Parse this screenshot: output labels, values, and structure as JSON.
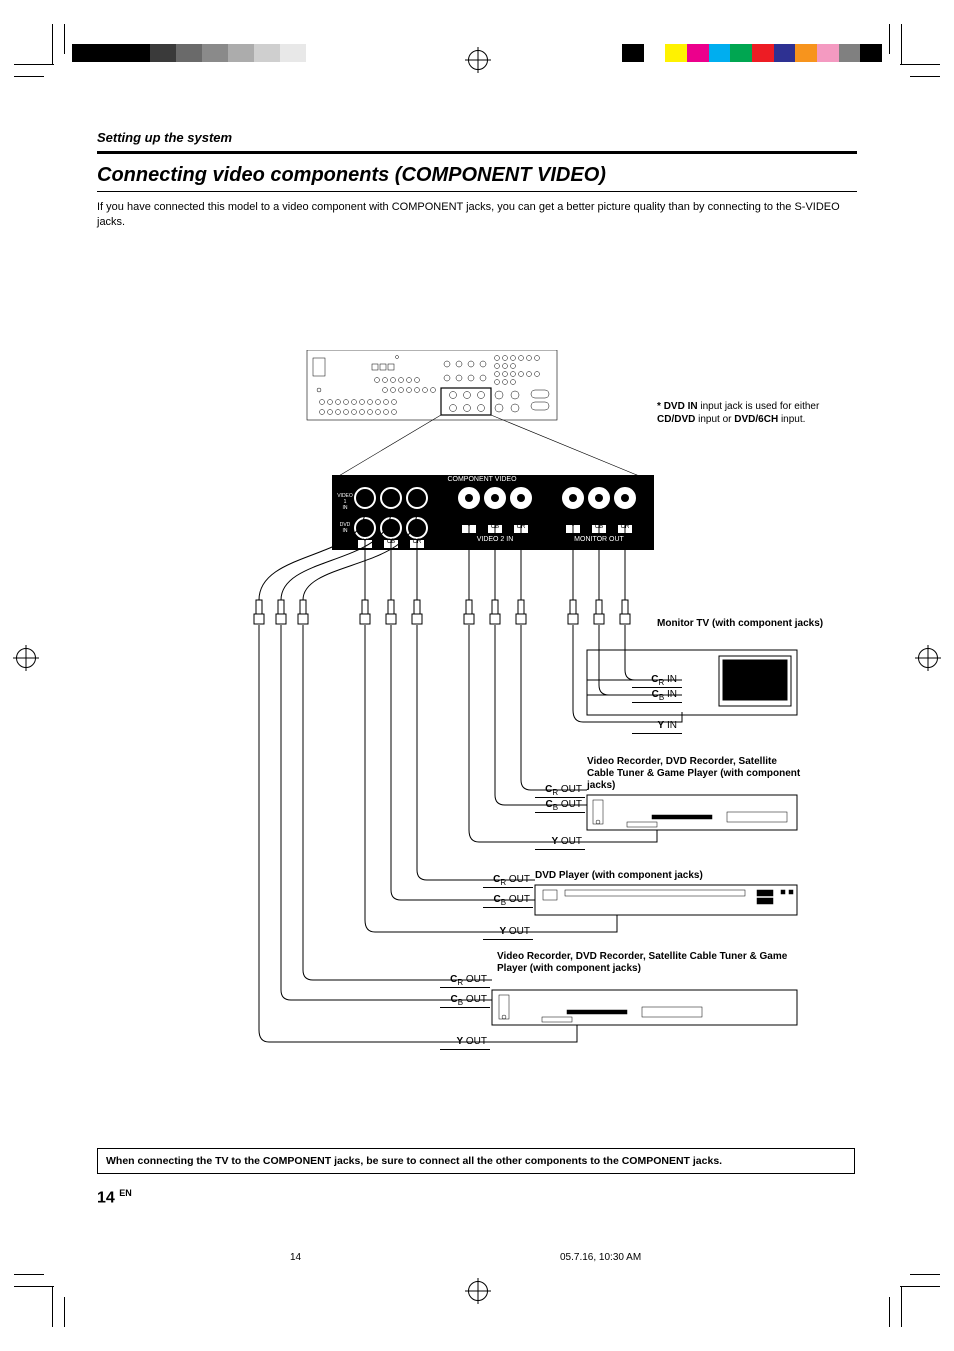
{
  "header": {
    "section": "Setting up the system",
    "title": "Connecting video components (COMPONENT VIDEO)",
    "intro": "If you have connected this model to a video component with COMPONENT jacks, you can get a better picture quality than by connecting to the S-VIDEO jacks."
  },
  "side_note": {
    "asterisk": "*",
    "bold1": "DVD IN",
    "text1": " input jack is used for either ",
    "bold2": "CD/DVD",
    "text2": " input or ",
    "bold3": "DVD/6CH",
    "text3": " input."
  },
  "panel": {
    "title": "COMPONENT VIDEO",
    "row_labels": [
      "VIDEO 1 IN",
      "DVD IN"
    ],
    "col_headers": [
      "VIDEO 2 IN",
      "MONITOR OUT"
    ],
    "jack_letters": [
      "Y",
      "CB",
      "CR"
    ]
  },
  "devices": {
    "monitor": {
      "title": "Monitor TV\n(with component jacks)",
      "sig": [
        "CR IN",
        "CB IN",
        "Y IN"
      ]
    },
    "vcr1": {
      "title": "Video Recorder, DVD Recorder, Satellite Cable Tuner & Game Player (with component jacks)",
      "sig": [
        "CR OUT",
        "CB OUT",
        "Y OUT"
      ]
    },
    "dvd": {
      "title": "DVD Player (with component jacks)",
      "sig": [
        "CR OUT",
        "CB OUT",
        "Y OUT"
      ]
    },
    "vcr2": {
      "title": "Video Recorder, DVD Recorder, Satellite Cable Tuner & Game Player (with component jacks)",
      "sig": [
        "CR OUT",
        "CB OUT",
        "Y OUT"
      ]
    }
  },
  "note_box": "When connecting the TV to the COMPONENT jacks, be sure to connect all the other components to the COMPONENT jacks.",
  "page_number": "14",
  "page_lang": "EN",
  "footer": {
    "left": "14",
    "right": "05.7.16, 10:30 AM"
  },
  "colors": {
    "strip_left": [
      "#000000",
      "#000000",
      "#000000",
      "#3a3a3a",
      "#6a6a6a",
      "#8a8a8a",
      "#acacac",
      "#cfcfcf",
      "#e8e8e8",
      "#ffffff"
    ],
    "strip_right": [
      "#000000",
      "#ffffff",
      "#fff200",
      "#ec008c",
      "#00aeef",
      "#00a651",
      "#ed1c24",
      "#2e3192",
      "#f7941d",
      "#f49ac1",
      "#808080",
      "#000000"
    ]
  }
}
